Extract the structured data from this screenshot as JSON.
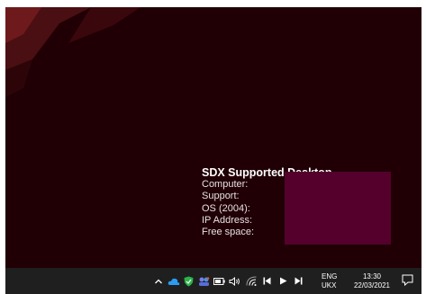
{
  "desktop": {
    "background_color": "#200005",
    "info": {
      "title": "SDX Supported Desktop",
      "rows": [
        "Computer:",
        "Support:",
        "OS (2004):",
        "IP Address:",
        "Free space:"
      ]
    },
    "redaction_color": "#55002c"
  },
  "taskbar": {
    "tray_icons": [
      "chevron-up-icon",
      "onedrive-cloud-icon",
      "security-shield-icon",
      "teams-icon",
      "battery-icon",
      "volume-icon",
      "wifi-icon",
      "previous-track-icon",
      "play-icon",
      "next-track-icon"
    ],
    "language": {
      "line1": "ENG",
      "line2": "UKX"
    },
    "clock": {
      "time": "13:30",
      "date": "22/03/2021"
    },
    "notification_icon": "notification-icon"
  }
}
